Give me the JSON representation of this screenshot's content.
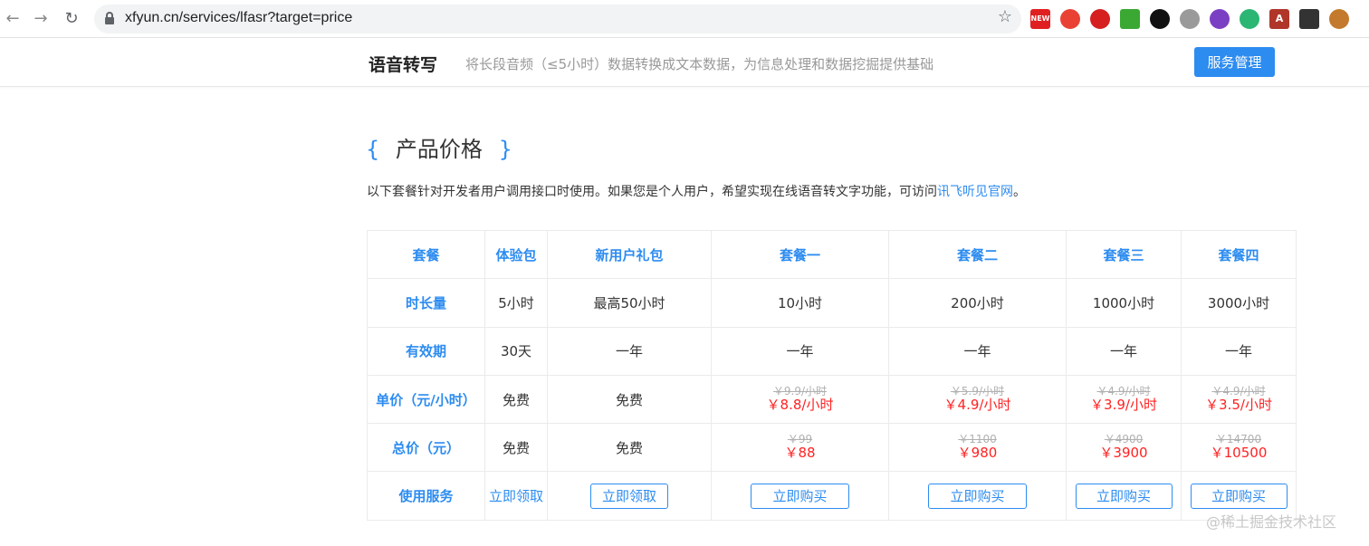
{
  "browser": {
    "url": "xfyun.cn/services/lfasr?target=price",
    "icons": [
      "back-arrow-icon",
      "forward-arrow-icon",
      "reload-icon",
      "lock-icon",
      "bookmark-star-icon"
    ],
    "extensions": [
      {
        "name": "new-badge-extension-icon",
        "label": "NEW",
        "color": "#e02020"
      },
      {
        "name": "pin-extension-icon",
        "label": "",
        "color": "#e94235"
      },
      {
        "name": "speaker-extension-icon",
        "label": "",
        "color": "#d61f1f"
      },
      {
        "name": "green-eye-extension-icon",
        "label": "",
        "color": "#3aa832"
      },
      {
        "name": "key-extension-icon",
        "label": "",
        "color": "#111111"
      },
      {
        "name": "v-extension-icon",
        "label": "",
        "color": "#9a9a9a"
      },
      {
        "name": "circle-extension-icon",
        "label": "",
        "color": "#7b3fc4"
      },
      {
        "name": "swirl-extension-icon",
        "label": "",
        "color": "#2bb673"
      },
      {
        "name": "a-extension-icon",
        "label": "A",
        "color": "#b0362a"
      },
      {
        "name": "qr-extension-icon",
        "label": "",
        "color": "#333333"
      },
      {
        "name": "owl-extension-icon",
        "label": "",
        "color": "#c47a2c"
      }
    ]
  },
  "header": {
    "title": "语音转写",
    "subtitle": "将长段音频（≤5小时）数据转换成文本数据，为信息处理和数据挖掘提供基础",
    "service_button": "服务管理"
  },
  "section": {
    "brace_open": "{",
    "title": "产品价格",
    "brace_close": "}",
    "intro_text": "以下套餐针对开发者用户调用接口时使用。如果您是个人用户，希望实现在线语音转文字功能，可访问",
    "intro_link": "讯飞听见官网",
    "intro_end": "。"
  },
  "table": {
    "headers": [
      "套餐",
      "体验包",
      "新用户礼包",
      "套餐一",
      "套餐二",
      "套餐三",
      "套餐四"
    ],
    "duration": {
      "label": "时长量",
      "values": [
        "5小时",
        "最高50小时",
        "10小时",
        "200小时",
        "1000小时",
        "3000小时"
      ]
    },
    "validity": {
      "label": "有效期",
      "values": [
        "30天",
        "一年",
        "一年",
        "一年",
        "一年",
        "一年"
      ]
    },
    "unit_price": {
      "label": "单价（元/小时）",
      "free": [
        "免费",
        "免费"
      ],
      "old": [
        "￥9.9/小时",
        "￥5.9/小时",
        "￥4.9/小时",
        "￥4.9/小时"
      ],
      "now": [
        "￥8.8/小时",
        "￥4.9/小时",
        "￥3.9/小时",
        "￥3.5/小时"
      ]
    },
    "total_price": {
      "label": "总价（元）",
      "free": [
        "免费",
        "免费"
      ],
      "old": [
        "￥99",
        "￥1100",
        "￥4900",
        "￥14700"
      ],
      "now": [
        "￥88",
        "￥980",
        "￥3900",
        "￥10500"
      ]
    },
    "service": {
      "label": "使用服务",
      "actions": [
        "立即领取",
        "立即领取",
        "立即购买",
        "立即购买",
        "立即购买",
        "立即购买"
      ]
    }
  },
  "watermark": "@稀土掘金技术社区",
  "colors": {
    "accent": "#2d8cf0",
    "price_red": "#ff2222",
    "muted": "#999999"
  }
}
